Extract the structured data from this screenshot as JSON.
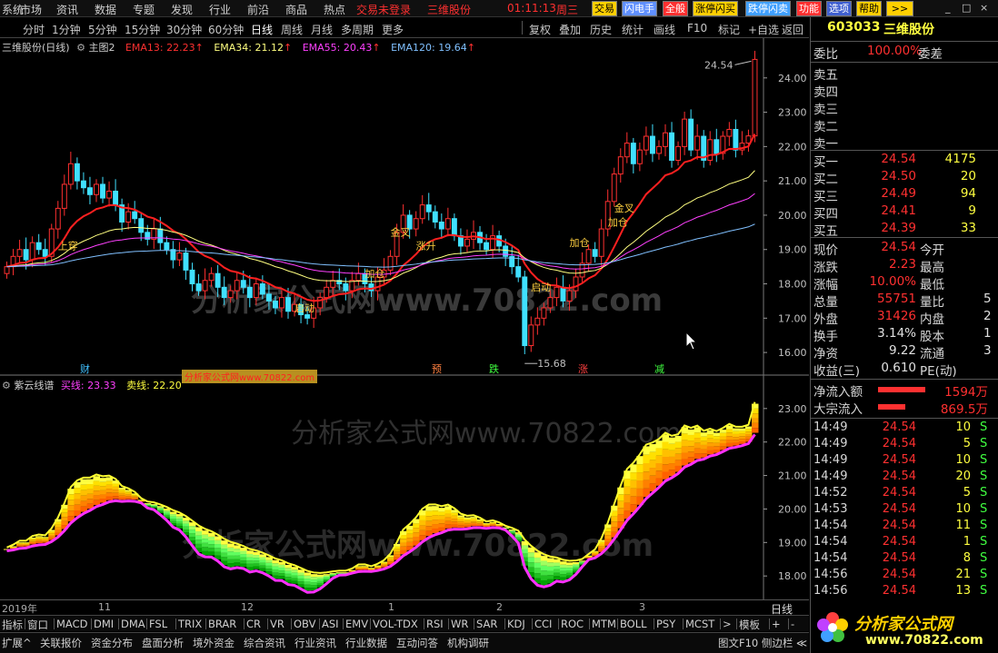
{
  "menubar": {
    "items": [
      "系统",
      "市场",
      "资讯",
      "数据",
      "专题",
      "发现",
      "行业",
      "前沿",
      "商品",
      "热点"
    ],
    "trade_status": "交易未登录",
    "stock_name": "三维股份",
    "clock": "01:11:13",
    "weekday": "周三",
    "buttons": [
      "交易",
      "闪电手",
      "全般",
      "涨停闪买",
      "跌停闪卖",
      "功能",
      "选项",
      "帮助",
      ">>"
    ],
    "window_controls": [
      "_",
      "□",
      "×"
    ]
  },
  "periodbar": {
    "periods": [
      "分时",
      "1分钟",
      "5分钟",
      "15分钟",
      "30分钟",
      "60分钟",
      "日线",
      "周线",
      "月线",
      "多周期",
      "更多"
    ],
    "active": "日线",
    "tools": [
      "复权",
      "叠加",
      "历史",
      "统计",
      "画线",
      "F10",
      "标记",
      "+自选",
      "返回"
    ]
  },
  "main_chart": {
    "title": "三维股份(日线)",
    "subtitle": "主图2",
    "ema": [
      {
        "label": "EMA13: 22.23",
        "color": "#ff3030"
      },
      {
        "label": "EMA34: 21.12",
        "color": "#ffff80"
      },
      {
        "label": "EMA55: 20.43",
        "color": "#ff40ff"
      },
      {
        "label": "EMA120: 19.64",
        "color": "#80c0ff"
      }
    ],
    "ylim": [
      15.5,
      25.0
    ],
    "y_ticks": [
      "24.00",
      "23.00",
      "22.00",
      "21.00",
      "20.00",
      "19.00",
      "18.00",
      "17.00",
      "16.00"
    ],
    "annotations": {
      "high": "24.54",
      "low": "15.68",
      "signals": [
        "上穿",
        "启动",
        "金叉",
        "加仓",
        "涨升",
        "加仓",
        "启动",
        "金叉",
        "加仓"
      ],
      "events": [
        {
          "label": "财",
          "color": "#40c0ff"
        },
        {
          "label": "预",
          "color": "#ff8040"
        },
        {
          "label": "跌",
          "color": "#40ff40"
        },
        {
          "label": "涨",
          "color": "#ff4040"
        },
        {
          "label": "减",
          "color": "#40ff40"
        }
      ]
    }
  },
  "sub_chart": {
    "title": "紫云线谱",
    "buy_label": "买线: 23.33",
    "sell_label": "卖线: 22.20",
    "y_ticks": [
      "23.00",
      "22.00",
      "21.00",
      "20.00",
      "19.00",
      "18.00"
    ],
    "ylim": [
      17.3,
      23.7
    ]
  },
  "watermark": {
    "text1": "分析家公式网www.70822.com",
    "text2": "分析家公式网www.70822.com",
    "text3": "分析家公式网www.70822.com",
    "tag": "分析家公式网www.70822.com"
  },
  "timeaxis": {
    "labels": [
      "2019年",
      "11",
      "12",
      "1",
      "2",
      "3"
    ],
    "period_button": "日线"
  },
  "indicator_tabs": [
    "指标",
    "窗口",
    "MACD",
    "DMI",
    "DMA",
    "FSL",
    "TRIX",
    "BRAR",
    "CR",
    "VR",
    "OBV",
    "ASI",
    "EMV",
    "VOL-TDX",
    "RSI",
    "WR",
    "SAR",
    "KDJ",
    "CCI",
    "ROC",
    "MTM",
    "BOLL",
    "PSY",
    "MCST",
    ">",
    "模板",
    "+",
    "-"
  ],
  "info_tabs": [
    "扩展^",
    "关联报价",
    "资金分布",
    "盘面分析",
    "境外资金",
    "综合资讯",
    "行业资讯",
    "行业数据",
    "互动问答",
    "机构调研"
  ],
  "info_right": "图文F10 侧边栏 ≪",
  "quote": {
    "code": "603033",
    "name": "三维股份",
    "weibi_label": "委比",
    "weibi": "100.00%",
    "weicha_label": "委差",
    "sell": [
      "卖五",
      "卖四",
      "卖三",
      "卖二",
      "卖一"
    ],
    "buy": [
      {
        "label": "买一",
        "price": "24.54",
        "vol": "4175"
      },
      {
        "label": "买二",
        "price": "24.50",
        "vol": "20"
      },
      {
        "label": "买三",
        "price": "24.49",
        "vol": "94"
      },
      {
        "label": "买四",
        "price": "24.41",
        "vol": "9"
      },
      {
        "label": "买五",
        "price": "24.39",
        "vol": "33"
      }
    ],
    "stats": [
      {
        "l1": "现价",
        "v1": "24.54",
        "l2": "今开",
        "v2": ""
      },
      {
        "l1": "涨跌",
        "v1": "2.23",
        "l2": "最高",
        "v2": ""
      },
      {
        "l1": "涨幅",
        "v1": "10.00%",
        "l2": "最低",
        "v2": ""
      },
      {
        "l1": "总量",
        "v1": "55751",
        "l2": "量比",
        "v2": "5"
      },
      {
        "l1": "外盘",
        "v1": "31426",
        "l2": "内盘",
        "v2": "2"
      },
      {
        "l1": "换手",
        "v1": "3.14%",
        "l2": "股本",
        "v2": "1"
      },
      {
        "l1": "净资",
        "v1": "9.22",
        "l2": "流通",
        "v2": "3"
      },
      {
        "l1": "收益(三)",
        "v1": "0.610",
        "l2": "PE(动)",
        "v2": ""
      }
    ],
    "net_inflow_label": "净流入额",
    "net_inflow": "1594万",
    "big_inflow_label": "大宗流入",
    "big_inflow": "869.5万",
    "ticks": [
      {
        "t": "14:49",
        "p": "24.54",
        "v": "10",
        "s": "S"
      },
      {
        "t": "14:49",
        "p": "24.54",
        "v": "5",
        "s": "S"
      },
      {
        "t": "14:49",
        "p": "24.54",
        "v": "10",
        "s": "S"
      },
      {
        "t": "14:49",
        "p": "24.54",
        "v": "20",
        "s": "S"
      },
      {
        "t": "14:52",
        "p": "24.54",
        "v": "5",
        "s": "S"
      },
      {
        "t": "14:53",
        "p": "24.54",
        "v": "10",
        "s": "S"
      },
      {
        "t": "14:54",
        "p": "24.54",
        "v": "11",
        "s": "S"
      },
      {
        "t": "14:54",
        "p": "24.54",
        "v": "1",
        "s": "S"
      },
      {
        "t": "14:54",
        "p": "24.54",
        "v": "8",
        "s": "S"
      },
      {
        "t": "14:56",
        "p": "24.54",
        "v": "21",
        "s": "S"
      },
      {
        "t": "14:56",
        "p": "24.54",
        "v": "13",
        "s": "S"
      }
    ]
  },
  "logo_text": "分析家公式网",
  "logo_url": "www.70822.com",
  "chart_data": {
    "type": "candlestick",
    "title": "三维股份(日线)",
    "ylim": [
      15.5,
      25.0
    ],
    "close": [
      18.5,
      18.8,
      19.0,
      18.7,
      19.2,
      19.0,
      18.8,
      19.6,
      20.2,
      20.9,
      21.5,
      21.0,
      20.8,
      20.6,
      20.9,
      20.5,
      20.7,
      20.3,
      19.8,
      20.1,
      19.9,
      19.5,
      19.3,
      19.6,
      19.2,
      19.0,
      18.7,
      18.9,
      18.4,
      18.0,
      17.8,
      18.1,
      18.3,
      17.9,
      17.6,
      17.8,
      18.1,
      17.9,
      17.6,
      18.0,
      17.7,
      17.5,
      17.3,
      17.6,
      17.2,
      17.4,
      17.1,
      17.0,
      17.3,
      17.6,
      17.9,
      18.1,
      18.0,
      17.8,
      18.1,
      18.3,
      18.0,
      17.8,
      18.2,
      18.4,
      18.8,
      19.5,
      20.0,
      19.6,
      19.9,
      20.3,
      20.1,
      19.8,
      19.6,
      19.9,
      19.4,
      19.1,
      19.3,
      19.5,
      19.2,
      19.0,
      19.4,
      19.1,
      18.8,
      18.5,
      18.2,
      16.2,
      16.8,
      17.0,
      17.3,
      17.6,
      17.9,
      17.5,
      17.8,
      18.2,
      18.6,
      19.0,
      18.8,
      19.6,
      20.4,
      21.2,
      21.7,
      22.1,
      21.5,
      21.9,
      22.3,
      21.8,
      22.0,
      22.4,
      21.6,
      22.0,
      22.8,
      21.9,
      22.3,
      21.6,
      22.2,
      21.8,
      22.3,
      22.5,
      21.9,
      22.1,
      22.31,
      24.54
    ],
    "ema13_last": 22.23,
    "ema34_last": 21.12,
    "ema55_last": 20.43,
    "ema120_last": 19.64
  }
}
